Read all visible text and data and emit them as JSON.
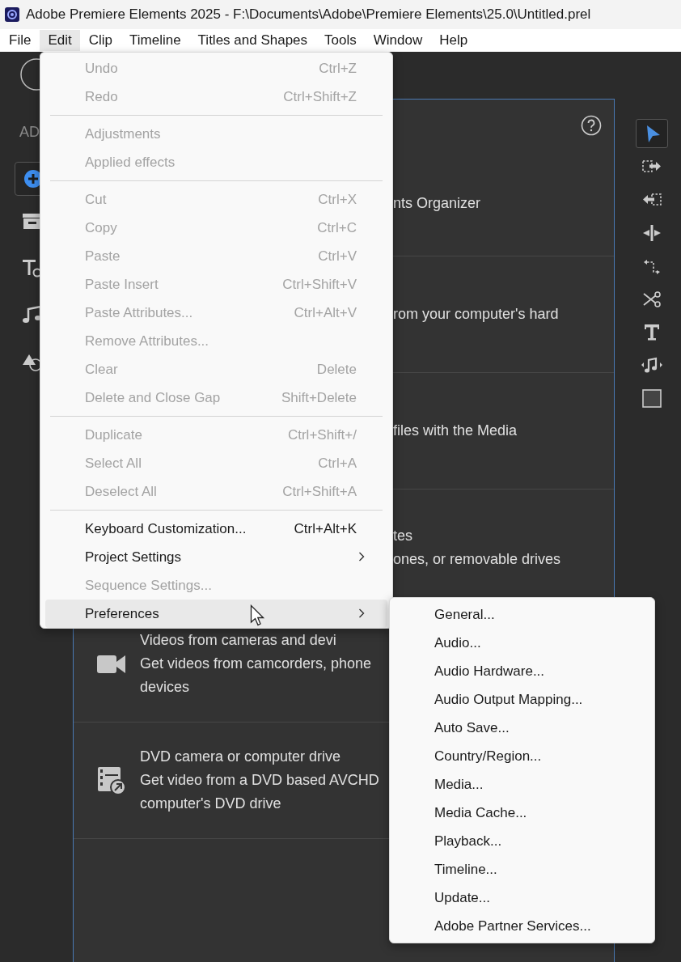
{
  "window": {
    "title": "Adobe Premiere Elements 2025 - F:\\Documents\\Adobe\\Premiere Elements\\25.0\\Untitled.prel"
  },
  "menu_bar": [
    {
      "label": "File",
      "selected": false
    },
    {
      "label": "Edit",
      "selected": true
    },
    {
      "label": "Clip",
      "selected": false
    },
    {
      "label": "Timeline",
      "selected": false
    },
    {
      "label": "Titles and Shapes",
      "selected": false
    },
    {
      "label": "Tools",
      "selected": false
    },
    {
      "label": "Window",
      "selected": false
    },
    {
      "label": "Help",
      "selected": false
    }
  ],
  "sidebar": {
    "heading": "AD"
  },
  "panel": {
    "rows": [
      {
        "lines": [
          "nts Organizer"
        ]
      },
      {
        "lines": [
          "rom your computer's hard"
        ]
      },
      {
        "lines": [
          "files with the Media"
        ]
      },
      {
        "lines": [
          "tes",
          "ones, or removable drives"
        ]
      },
      {
        "kind": "camera",
        "lines": [
          "Videos from cameras and devi",
          "Get videos from camcorders, phone",
          "devices"
        ]
      },
      {
        "kind": "film",
        "lines": [
          "DVD camera or computer drive",
          "Get video from a DVD based AVCHD",
          "computer's DVD drive"
        ]
      }
    ]
  },
  "tools": [
    {
      "kind": "select",
      "selected": true
    },
    {
      "kind": "extract",
      "selected": false
    },
    {
      "kind": "lift",
      "selected": false
    },
    {
      "kind": "split",
      "selected": false
    },
    {
      "kind": "rearrange",
      "selected": false
    },
    {
      "kind": "scissors",
      "selected": false
    },
    {
      "kind": "text",
      "selected": false
    },
    {
      "kind": "music",
      "selected": false
    },
    {
      "kind": "shape",
      "selected": false
    }
  ],
  "edit_menu": {
    "groups": [
      [
        {
          "label": "Undo",
          "shortcut": "Ctrl+Z",
          "disabled": true,
          "selected": false
        },
        {
          "label": "Redo",
          "shortcut": "Ctrl+Shift+Z",
          "disabled": true,
          "selected": false
        }
      ],
      [
        {
          "label": "Adjustments",
          "disabled": true,
          "selected": false
        },
        {
          "label": "Applied effects",
          "disabled": true,
          "selected": false
        }
      ],
      [
        {
          "label": "Cut",
          "shortcut": "Ctrl+X",
          "disabled": true,
          "selected": false
        },
        {
          "label": "Copy",
          "shortcut": "Ctrl+C",
          "disabled": true,
          "selected": false
        },
        {
          "label": "Paste",
          "shortcut": "Ctrl+V",
          "disabled": true,
          "selected": false
        },
        {
          "label": "Paste Insert",
          "shortcut": "Ctrl+Shift+V",
          "disabled": true,
          "selected": false
        },
        {
          "label": "Paste Attributes...",
          "shortcut": "Ctrl+Alt+V",
          "disabled": true,
          "selected": false
        },
        {
          "label": "Remove Attributes...",
          "disabled": true,
          "selected": false
        },
        {
          "label": "Clear",
          "shortcut": "Delete",
          "disabled": true,
          "selected": false
        },
        {
          "label": "Delete and Close Gap",
          "shortcut": "Shift+Delete",
          "disabled": true,
          "selected": false
        }
      ],
      [
        {
          "label": "Duplicate",
          "shortcut": "Ctrl+Shift+/",
          "disabled": true,
          "selected": false
        },
        {
          "label": "Select All",
          "shortcut": "Ctrl+A",
          "disabled": true,
          "selected": false
        },
        {
          "label": "Deselect All",
          "shortcut": "Ctrl+Shift+A",
          "disabled": true,
          "selected": false
        }
      ],
      [
        {
          "label": "Keyboard Customization...",
          "shortcut": "Ctrl+Alt+K",
          "disabled": false,
          "selected": false
        },
        {
          "label": "Project Settings",
          "submenu": true,
          "disabled": false,
          "selected": false
        },
        {
          "label": "Sequence Settings...",
          "disabled": true,
          "selected": false
        },
        {
          "label": "Preferences",
          "submenu": true,
          "disabled": false,
          "selected": true
        }
      ]
    ]
  },
  "preferences_submenu": {
    "items": [
      "General...",
      "Audio...",
      "Audio Hardware...",
      "Audio Output Mapping...",
      "Auto Save...",
      "Country/Region...",
      "Media...",
      "Media Cache...",
      "Playback...",
      "Timeline...",
      "Update...",
      "Adobe Partner Services..."
    ]
  }
}
